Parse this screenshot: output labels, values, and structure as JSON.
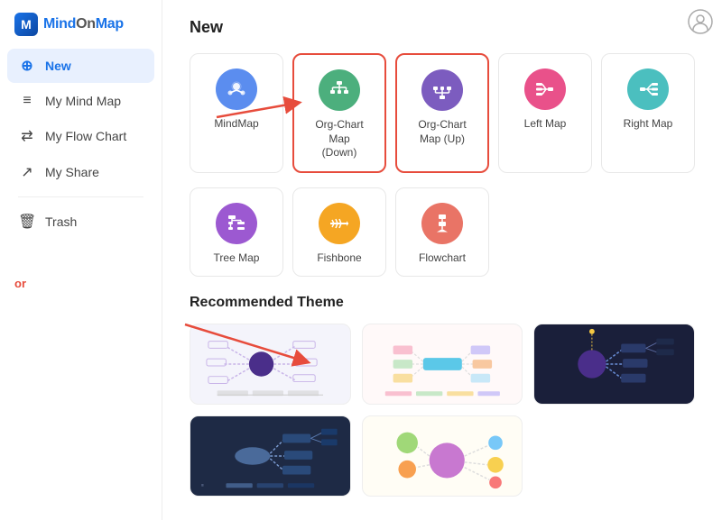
{
  "logo": {
    "text": "MindOnMap",
    "text_mind": "Mind",
    "text_on": "On",
    "text_map": "Map"
  },
  "sidebar": {
    "items": [
      {
        "id": "new",
        "label": "New",
        "icon": "➕",
        "active": true
      },
      {
        "id": "my-mind-map",
        "label": "My Mind Map",
        "icon": "🗺",
        "active": false
      },
      {
        "id": "my-flow-chart",
        "label": "My Flow Chart",
        "icon": "⇄",
        "active": false
      },
      {
        "id": "my-share",
        "label": "My Share",
        "icon": "↗",
        "active": false
      },
      {
        "id": "trash",
        "label": "Trash",
        "icon": "🗑",
        "active": false
      }
    ],
    "or_label": "or"
  },
  "main": {
    "new_section_title": "New",
    "map_types_row1": [
      {
        "id": "mindmap",
        "label": "MindMap",
        "color": "#5b8def",
        "icon": "💡"
      },
      {
        "id": "org-chart-down",
        "label": "Org-Chart Map\n(Down)",
        "color": "#4caf7d",
        "icon": "⊕",
        "highlighted": true
      },
      {
        "id": "org-chart-up",
        "label": "Org-Chart Map (Up)",
        "color": "#7c5cbf",
        "icon": "⊖",
        "highlighted": true
      },
      {
        "id": "left-map",
        "label": "Left Map",
        "color": "#e9518a",
        "icon": "⇦"
      },
      {
        "id": "right-map",
        "label": "Right Map",
        "color": "#4bbfbf",
        "icon": "⇨"
      }
    ],
    "map_types_row2": [
      {
        "id": "tree-map",
        "label": "Tree Map",
        "color": "#9c59d1",
        "icon": "⊞"
      },
      {
        "id": "fishbone",
        "label": "Fishbone",
        "color": "#f5a623",
        "icon": "✦"
      },
      {
        "id": "flowchart",
        "label": "Flowchart",
        "color": "#e97466",
        "icon": "⇄"
      }
    ],
    "recommended_title": "Recommended Theme",
    "themes": [
      {
        "id": "theme-1",
        "type": "light",
        "bg": "#f4f4fb"
      },
      {
        "id": "theme-2",
        "type": "light2",
        "bg": "#fff9f9"
      },
      {
        "id": "theme-3",
        "type": "dark1",
        "bg": "#1a1f3a"
      },
      {
        "id": "theme-4",
        "type": "dark2",
        "bg": "#1e2a45"
      },
      {
        "id": "theme-5",
        "type": "light3",
        "bg": "#fffdf5"
      }
    ]
  }
}
